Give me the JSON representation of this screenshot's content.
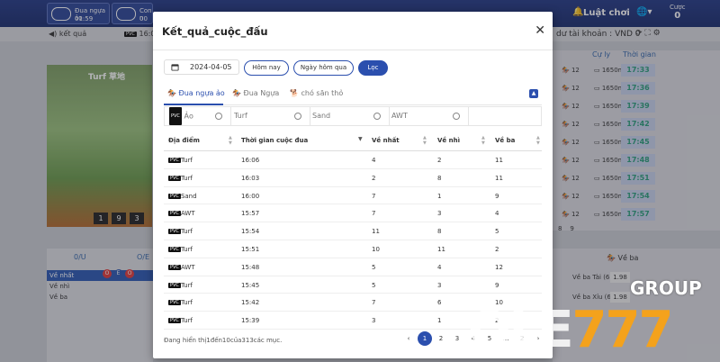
{
  "app": {
    "tabs": [
      {
        "label": "Đua ngựa ảo",
        "time": "01:59"
      },
      {
        "label": "Con n",
        "time": "00"
      }
    ],
    "luat_choi": "Luật chơi",
    "cuoc_label": "Cược",
    "cuoc_value": "0",
    "ket_qua": "kết quả",
    "video_time": "16:06",
    "account": "dư tài khoản : VND 0",
    "video_label": "Turf 草地",
    "video_boxes": [
      "1",
      "9",
      "3"
    ],
    "right_header": [
      "Cự ly",
      "Thời gian"
    ],
    "right_rows": [
      {
        "n": "12",
        "dist": "1650m",
        "time": "17:33"
      },
      {
        "n": "12",
        "dist": "1650m",
        "time": "17:36"
      },
      {
        "n": "12",
        "dist": "1650m",
        "time": "17:39"
      },
      {
        "n": "12",
        "dist": "1650m",
        "time": "17:42"
      },
      {
        "n": "12",
        "dist": "1650m",
        "time": "17:45"
      },
      {
        "n": "12",
        "dist": "1650m",
        "time": "17:48"
      },
      {
        "n": "12",
        "dist": "1650m",
        "time": "17:51"
      },
      {
        "n": "12",
        "dist": "1650m",
        "time": "17:54"
      },
      {
        "n": "12",
        "dist": "1650m",
        "time": "17:57"
      }
    ],
    "right_pages": [
      "8",
      "9"
    ],
    "left_headers": [
      "0/U",
      "O/E"
    ],
    "left_rows": [
      "Về nhất",
      "Về nhì",
      "Về ba"
    ],
    "ve_ba": "Về ba",
    "ve_ba_rows": [
      {
        "label": "Về ba Tài (6.5)",
        "val": "1.98"
      },
      {
        "label": "Về ba Xỉu (6.5)",
        "val": "1.98"
      }
    ],
    "pvc": "PVC"
  },
  "modal": {
    "title": "Kết_quả_cuộc_đấu",
    "date": "2024-04-05",
    "btn_today": "Hôm nay",
    "btn_yesterday": "Ngày hôm qua",
    "btn_filter": "Lọc",
    "tabs": [
      "Đua ngựa ảo",
      "Đua Ngựa",
      "chó săn thỏ"
    ],
    "surfaces": [
      "Ảo",
      "Turf",
      "Sand",
      "AWT"
    ],
    "columns": [
      "Địa điểm",
      "Thời gian cuộc đua",
      "Về nhất",
      "Về nhì",
      "Về ba"
    ],
    "rows": [
      {
        "place": "Turf",
        "time": "16:06",
        "first": "4",
        "second": "2",
        "third": "11"
      },
      {
        "place": "Turf",
        "time": "16:03",
        "first": "2",
        "second": "8",
        "third": "11"
      },
      {
        "place": "Sand",
        "time": "16:00",
        "first": "7",
        "second": "1",
        "third": "9"
      },
      {
        "place": "AWT",
        "time": "15:57",
        "first": "7",
        "second": "3",
        "third": "4"
      },
      {
        "place": "Turf",
        "time": "15:54",
        "first": "11",
        "second": "8",
        "third": "5"
      },
      {
        "place": "Turf",
        "time": "15:51",
        "first": "10",
        "second": "11",
        "third": "2"
      },
      {
        "place": "AWT",
        "time": "15:48",
        "first": "5",
        "second": "4",
        "third": "12"
      },
      {
        "place": "Turf",
        "time": "15:45",
        "first": "5",
        "second": "3",
        "third": "9"
      },
      {
        "place": "Turf",
        "time": "15:42",
        "first": "7",
        "second": "6",
        "third": "10"
      },
      {
        "place": "Turf",
        "time": "15:39",
        "first": "3",
        "second": "1",
        "third": "2"
      }
    ],
    "footer": "Đang hiển thị1đến10của313các mục.",
    "pager": [
      "‹",
      "1",
      "2",
      "3",
      "4",
      "5",
      "…",
      "2",
      "›"
    ]
  },
  "watermark": {
    "group": "GROUP",
    "logo_a": "OLE",
    "logo_b": "777"
  },
  "colors": {
    "primary": "#2b4fae",
    "time_green": "#2a9d7a",
    "header_blue": "#243a86"
  }
}
